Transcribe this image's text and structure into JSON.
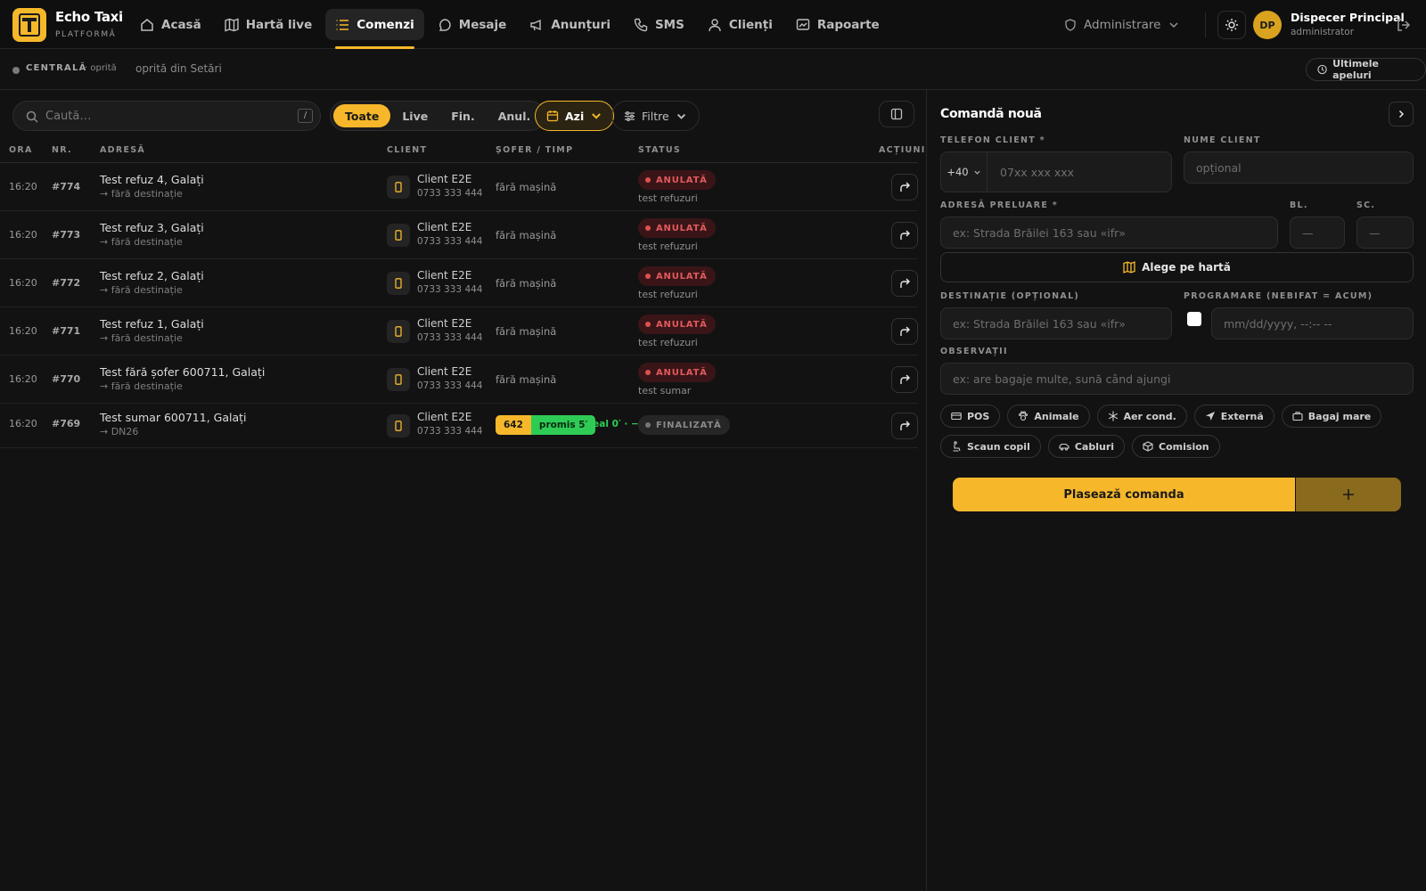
{
  "brand": {
    "name": "Echo Taxi",
    "subtitle": "PLATFORMĂ"
  },
  "nav": [
    {
      "label": "Acasă",
      "icon": "home-icon"
    },
    {
      "label": "Hartă live",
      "icon": "map-icon"
    },
    {
      "label": "Comenzi",
      "icon": "list-icon",
      "active": true
    },
    {
      "label": "Mesaje",
      "icon": "chat-icon"
    },
    {
      "label": "Anunțuri",
      "icon": "megaphone-icon"
    },
    {
      "label": "SMS",
      "icon": "phone-icon"
    },
    {
      "label": "Clienți",
      "icon": "user-icon"
    },
    {
      "label": "Rapoarte",
      "icon": "chart-icon"
    }
  ],
  "admin": {
    "label": "Administrare"
  },
  "user": {
    "initials": "DP",
    "name": "Dispecer Principal",
    "role": "administrator"
  },
  "status": {
    "central": "CENTRALĂ",
    "state": "· oprită",
    "note": "oprită din Setări",
    "last_calls": "Ultimele apeluri"
  },
  "toolbar": {
    "search_placeholder": "Caută…",
    "shortcut": "/",
    "segments": [
      "Toate",
      "Live",
      "Fin.",
      "Anul."
    ],
    "active_segment": "Toate",
    "date_label": "Azi",
    "filters_label": "Filtre"
  },
  "table": {
    "headers": [
      "ORA",
      "NR.",
      "ADRESĂ",
      "CLIENT",
      "ȘOFER / TIMP",
      "STATUS",
      "ACȚIUNI"
    ],
    "rows": [
      {
        "time": "16:20",
        "nr": "#774",
        "address": "Test refuz 4, Galați",
        "dest": "→ fără destinație",
        "client": "Client E2E",
        "phone": "0733 333 444",
        "driver": "fără mașină",
        "status": "ANULATĂ",
        "reason": "test refuzuri"
      },
      {
        "time": "16:20",
        "nr": "#773",
        "address": "Test refuz 3, Galați",
        "dest": "→ fără destinație",
        "client": "Client E2E",
        "phone": "0733 333 444",
        "driver": "fără mașină",
        "status": "ANULATĂ",
        "reason": "test refuzuri"
      },
      {
        "time": "16:20",
        "nr": "#772",
        "address": "Test refuz 2, Galați",
        "dest": "→ fără destinație",
        "client": "Client E2E",
        "phone": "0733 333 444",
        "driver": "fără mașină",
        "status": "ANULATĂ",
        "reason": "test refuzuri"
      },
      {
        "time": "16:20",
        "nr": "#771",
        "address": "Test refuz 1, Galați",
        "dest": "→ fără destinație",
        "client": "Client E2E",
        "phone": "0733 333 444",
        "driver": "fără mașină",
        "status": "ANULATĂ",
        "reason": "test refuzuri"
      },
      {
        "time": "16:20",
        "nr": "#770",
        "address": "Test fără șofer 600711, Galați",
        "dest": "→ fără destinație",
        "client": "Client E2E",
        "phone": "0733 333 444",
        "driver": "fără mașină",
        "status": "ANULATĂ",
        "reason": "test sumar"
      }
    ],
    "finished_row": {
      "time": "16:20",
      "nr": "#769",
      "address": "Test sumar 600711, Galați",
      "dest": "→ DN26",
      "client": "Client E2E",
      "phone": "0733 333 444",
      "car": "642",
      "promised": "promis 5′",
      "real": "real 0′ · −5",
      "status": "FINALIZATĂ"
    }
  },
  "form": {
    "title": "Comandă nouă",
    "phone_label": "TELEFON CLIENT *",
    "phone_prefix": "+40",
    "phone_placeholder": "07xx xxx xxx",
    "name_label": "NUME CLIENT",
    "name_placeholder": "opțional",
    "pickup_label": "ADRESĂ PRELUARE *",
    "pickup_placeholder": "ex: Strada Brăilei 163 sau «ifr»",
    "bl_label": "BL.",
    "bl_placeholder": "—",
    "sc_label": "SC.",
    "sc_placeholder": "—",
    "map_button": "Alege pe hartă",
    "dest_label": "DESTINAȚIE (OPȚIONAL)",
    "dest_placeholder": "ex: Strada Brăilei 163 sau «ifr»",
    "schedule_label": "PROGRAMARE (NEBIFAT = ACUM)",
    "schedule_placeholder": "mm/dd/yyyy, --:-- --",
    "notes_label": "OBSERVAȚII",
    "notes_placeholder": "ex: are bagaje multe, sună când ajungi",
    "chips_row1": [
      "POS",
      "Animale",
      "Aer cond.",
      "Externă",
      "Bagaj mare"
    ],
    "chips_row2": [
      "Scaun copil",
      "Cabluri",
      "Comision"
    ],
    "submit": "Plasează comanda"
  },
  "colors": {
    "accent": "#f6b82a",
    "cancel": "#e05a5a",
    "success": "#2ecc55",
    "background": "#121212"
  }
}
